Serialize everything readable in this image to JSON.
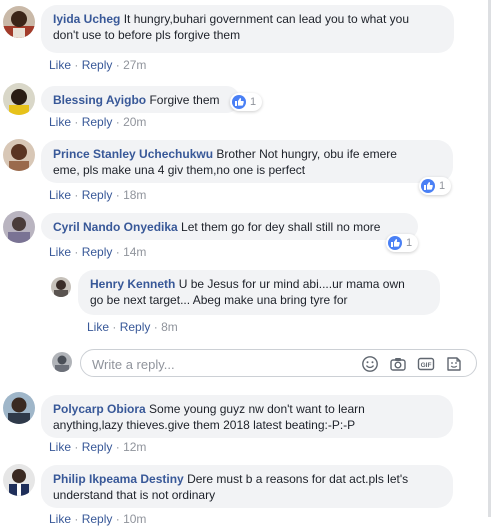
{
  "like_label": "Like",
  "reply_label": "Reply",
  "separator": "·",
  "comments": [
    {
      "author": "Iyida Ucheg",
      "text_line1": "It hungry,buhari government can lead you to what you",
      "text_line2": "don't use to before pls forgive them",
      "time": "27m"
    },
    {
      "author": "Blessing Ayigbo",
      "text_line1": "Forgive them",
      "time": "20m",
      "reactions": "1"
    },
    {
      "author": "Prince Stanley Uchechukwu",
      "text_line1": "Brother Not hungry, obu ife emere",
      "text_line2": "eme, pls make una 4 giv them,no one is perfect",
      "time": "18m",
      "reactions": "1"
    },
    {
      "author": "Cyril Nando Onyedika",
      "text_line1": "Let them go for dey shall still no more",
      "time": "14m",
      "reactions": "1"
    },
    {
      "author": "Polycarp Obiora",
      "text_line1": "Some young guyz nw don't want to learn",
      "text_line2": "anything,lazy thieves.give them 2018 latest beating:-P:-P",
      "time": "12m"
    },
    {
      "author": "Philip Ikpeama Destiny",
      "text_line1": "Dere must b a reasons for dat act.pls let's",
      "text_line2": "understand that is not ordinary",
      "time": "10m"
    }
  ],
  "nested_reply": {
    "author": "Henry Kenneth",
    "text_line1": "U be Jesus for ur mind abi....ur mama own",
    "text_line2": "go be next target... Abeg make una bring tyre for",
    "time": "8m"
  },
  "reply_box": {
    "placeholder": "Write a reply..."
  },
  "colors": {
    "link": "#385898",
    "bubble": "#f2f3f5",
    "meta": "#90949c",
    "like_badge": "#4a80f5"
  }
}
